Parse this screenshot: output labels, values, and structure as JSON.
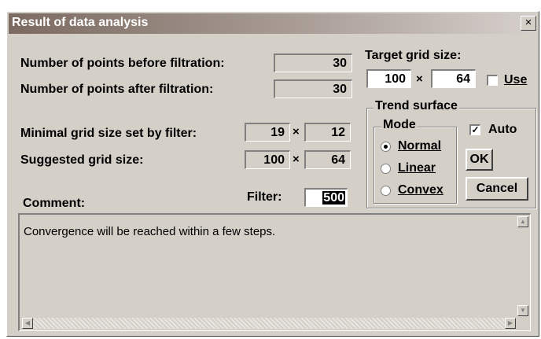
{
  "window": {
    "title": "Result of data analysis",
    "close_glyph": "×"
  },
  "analysis": {
    "points_before_label": "Number of points before filtration:",
    "points_before_value": "30",
    "points_after_label": "Number of points after filtration:",
    "points_after_value": "30",
    "min_grid_label": "Minimal grid size set by filter:",
    "min_grid_x": "19",
    "min_grid_y": "12",
    "suggested_label": "Suggested grid size:",
    "suggested_x": "100",
    "suggested_y": "64",
    "times_glyph": "×",
    "filter_label": "Filter:",
    "filter_value": "500",
    "comment_label": "Comment:"
  },
  "target": {
    "label": "Target grid size:",
    "x": "100",
    "y": "64",
    "use_label": "Use",
    "use_checked": false
  },
  "trend": {
    "group_label": "Trend surface",
    "mode_label": "Mode",
    "modes": [
      {
        "label": "Normal",
        "selected": true
      },
      {
        "label": "Linear",
        "selected": false
      },
      {
        "label": "Convex",
        "selected": false
      }
    ],
    "auto_label": "Auto",
    "auto_checked": true,
    "check_glyph": "✓"
  },
  "buttons": {
    "ok": "OK",
    "cancel": "Cancel"
  },
  "comment": {
    "text": "Convergence will be reached within a few steps."
  },
  "icons": {
    "scroll_up": "up-arrow-icon",
    "scroll_down": "down-arrow-icon",
    "scroll_left": "left-arrow-icon",
    "scroll_right": "right-arrow-icon"
  }
}
